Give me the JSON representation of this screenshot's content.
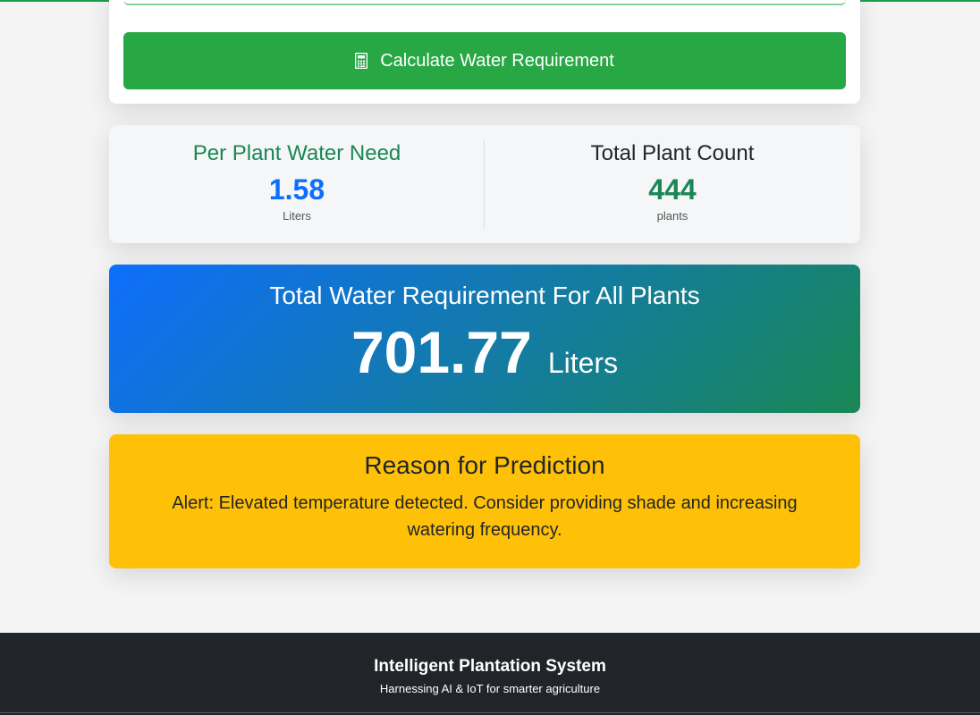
{
  "form": {
    "calculate_button_label": "Calculate Water Requirement",
    "calculate_icon": "calculator-icon"
  },
  "stats": {
    "per_plant": {
      "title": "Per Plant Water Need",
      "value": "1.58",
      "unit": "Liters"
    },
    "plant_count": {
      "title": "Total Plant Count",
      "value": "444",
      "unit": "plants"
    }
  },
  "total": {
    "title": "Total Water Requirement For All Plants",
    "value": "701.77",
    "unit": "Liters"
  },
  "reason": {
    "title": "Reason for Prediction",
    "text": "Alert: Elevated temperature detected. Consider providing shade and increasing watering frequency."
  },
  "footer": {
    "title": "Intelligent Plantation System",
    "subtitle": "Harnessing AI & IoT for smarter agriculture"
  },
  "colors": {
    "primary_green": "#28a745",
    "blue": "#0d6efd",
    "dark_green": "#198754",
    "warning": "#ffc107",
    "footer_bg": "#212529"
  }
}
